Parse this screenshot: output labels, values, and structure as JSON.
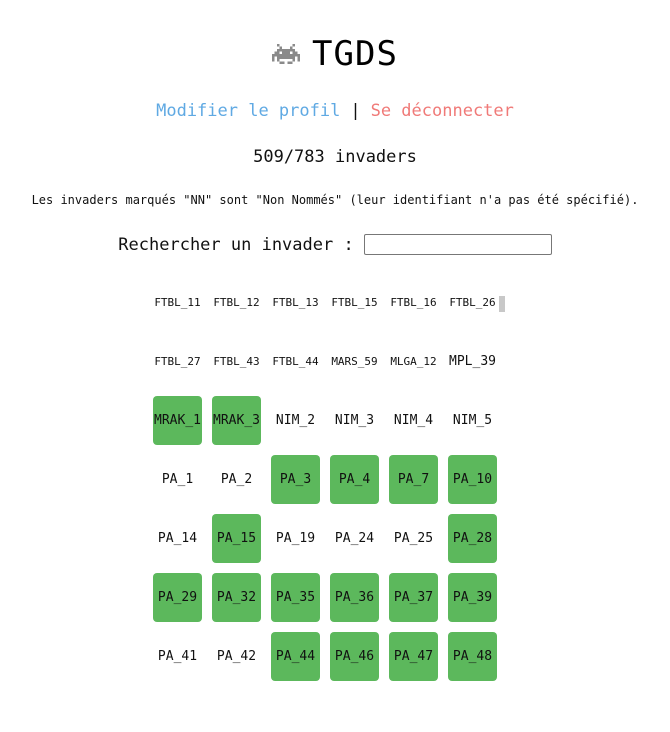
{
  "header": {
    "title": "TGDS",
    "logo_icon": "space-invader-icon"
  },
  "nav": {
    "edit_profile": "Modifier le profil",
    "separator": "|",
    "logout": "Se déconnecter"
  },
  "stats": {
    "count_text": "509/783 invaders"
  },
  "note": "Les invaders marqués \"NN\" sont \"Non Nommés\" (leur identifiant n'a pas été spécifié).",
  "search": {
    "label": "Rechercher un invader :",
    "value": "",
    "placeholder": ""
  },
  "colors": {
    "found": "#5cb85c",
    "edit_link": "#5fa9e3",
    "logout_link": "#f07a78"
  },
  "invaders": [
    {
      "id": "FTBL_11",
      "found": false
    },
    {
      "id": "FTBL_12",
      "found": false
    },
    {
      "id": "FTBL_13",
      "found": false
    },
    {
      "id": "FTBL_15",
      "found": false
    },
    {
      "id": "FTBL_16",
      "found": false
    },
    {
      "id": "FTBL_26",
      "found": false
    },
    {
      "id": "FTBL_27",
      "found": false
    },
    {
      "id": "FTBL_43",
      "found": false
    },
    {
      "id": "FTBL_44",
      "found": false
    },
    {
      "id": "MARS_59",
      "found": false
    },
    {
      "id": "MLGA_12",
      "found": false
    },
    {
      "id": "MPL_39",
      "found": false
    },
    {
      "id": "MRAK_1",
      "found": true
    },
    {
      "id": "MRAK_3",
      "found": true
    },
    {
      "id": "NIM_2",
      "found": false
    },
    {
      "id": "NIM_3",
      "found": false
    },
    {
      "id": "NIM_4",
      "found": false
    },
    {
      "id": "NIM_5",
      "found": false
    },
    {
      "id": "PA_1",
      "found": false
    },
    {
      "id": "PA_2",
      "found": false
    },
    {
      "id": "PA_3",
      "found": true
    },
    {
      "id": "PA_4",
      "found": true
    },
    {
      "id": "PA_7",
      "found": true
    },
    {
      "id": "PA_10",
      "found": true
    },
    {
      "id": "PA_14",
      "found": false
    },
    {
      "id": "PA_15",
      "found": true
    },
    {
      "id": "PA_19",
      "found": false
    },
    {
      "id": "PA_24",
      "found": false
    },
    {
      "id": "PA_25",
      "found": false
    },
    {
      "id": "PA_28",
      "found": true
    },
    {
      "id": "PA_29",
      "found": true
    },
    {
      "id": "PA_32",
      "found": true
    },
    {
      "id": "PA_35",
      "found": true
    },
    {
      "id": "PA_36",
      "found": true
    },
    {
      "id": "PA_37",
      "found": true
    },
    {
      "id": "PA_39",
      "found": true
    },
    {
      "id": "PA_41",
      "found": false
    },
    {
      "id": "PA_42",
      "found": false
    },
    {
      "id": "PA_44",
      "found": true
    },
    {
      "id": "PA_46",
      "found": true
    },
    {
      "id": "PA_47",
      "found": true
    },
    {
      "id": "PA_48",
      "found": true
    }
  ]
}
